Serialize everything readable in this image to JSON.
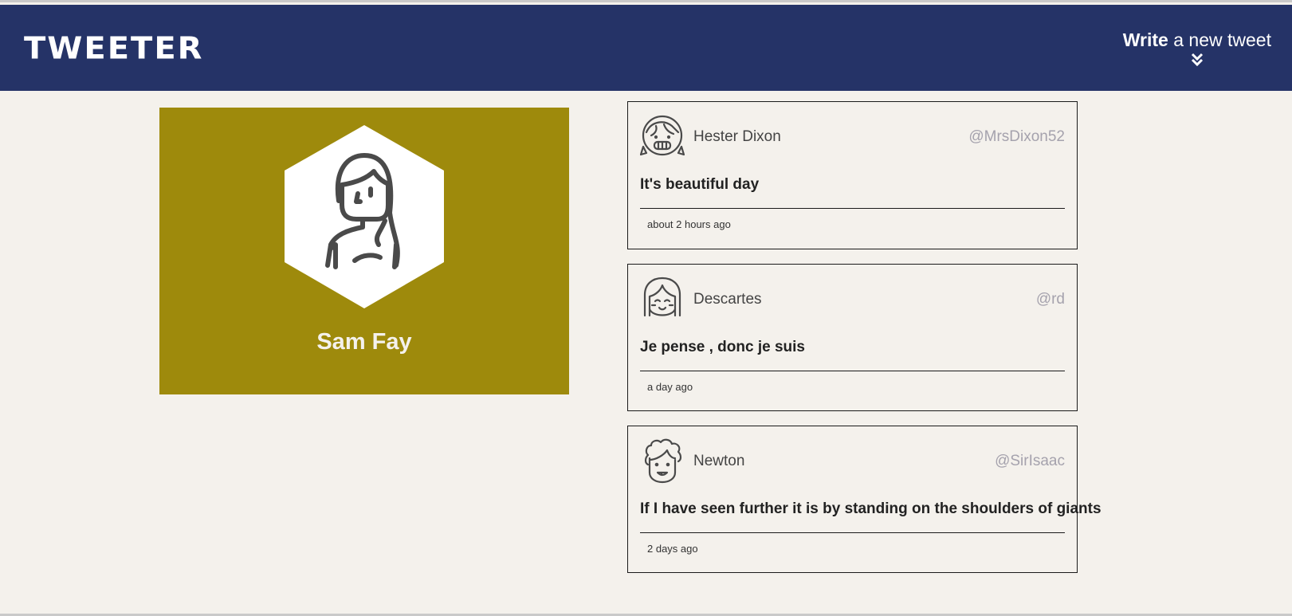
{
  "header": {
    "logo": "TWEETER",
    "compose_bold": "Write",
    "compose_rest": " a new tweet",
    "compose_icon": "double-chevron-down-icon",
    "background": "#253367"
  },
  "profile": {
    "name": "Sam Fay",
    "background": "#9e8a0c",
    "avatar_icon": "woman-avatar-icon"
  },
  "tweets": [
    {
      "name": "Hester Dixon",
      "handle": "@MrsDixon52",
      "text": "It's beautiful day",
      "time": "about 2 hours ago",
      "avatar_icon": "girl-pigtails-avatar-icon"
    },
    {
      "name": "Descartes",
      "handle": "@rd",
      "text": "Je pense , donc je suis",
      "time": "a day ago",
      "avatar_icon": "bob-hair-avatar-icon"
    },
    {
      "name": "Newton",
      "handle": "@SirIsaac",
      "text": "If I have seen further it is by standing on the shoulders of giants",
      "time": "2 days ago",
      "avatar_icon": "curly-hair-avatar-icon"
    }
  ]
}
